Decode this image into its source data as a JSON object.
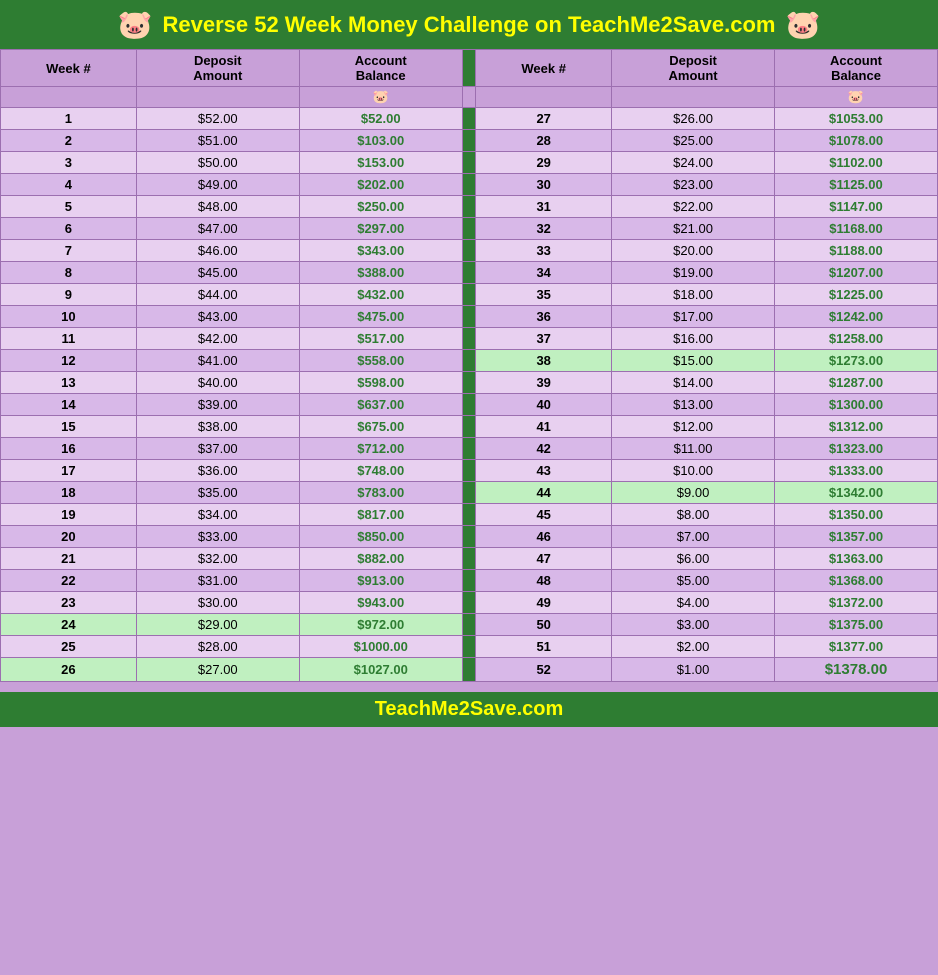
{
  "header": {
    "title": "Reverse 52 Week Money Challenge on TeachMe2Save.com",
    "pig_left": "🐷",
    "pig_right": "🐷"
  },
  "columns": {
    "week": "Week #",
    "deposit": "Deposit Amount",
    "balance": "Account Balance"
  },
  "footer": {
    "text": "TeachMe2Save.com"
  },
  "left_rows": [
    {
      "week": "1",
      "deposit": "$52.00",
      "balance": "$52.00",
      "highlight": false
    },
    {
      "week": "2",
      "deposit": "$51.00",
      "balance": "$103.00",
      "highlight": false
    },
    {
      "week": "3",
      "deposit": "$50.00",
      "balance": "$153.00",
      "highlight": false
    },
    {
      "week": "4",
      "deposit": "$49.00",
      "balance": "$202.00",
      "highlight": false
    },
    {
      "week": "5",
      "deposit": "$48.00",
      "balance": "$250.00",
      "highlight": false
    },
    {
      "week": "6",
      "deposit": "$47.00",
      "balance": "$297.00",
      "highlight": false
    },
    {
      "week": "7",
      "deposit": "$46.00",
      "balance": "$343.00",
      "highlight": false
    },
    {
      "week": "8",
      "deposit": "$45.00",
      "balance": "$388.00",
      "highlight": false
    },
    {
      "week": "9",
      "deposit": "$44.00",
      "balance": "$432.00",
      "highlight": false
    },
    {
      "week": "10",
      "deposit": "$43.00",
      "balance": "$475.00",
      "highlight": false
    },
    {
      "week": "11",
      "deposit": "$42.00",
      "balance": "$517.00",
      "highlight": false
    },
    {
      "week": "12",
      "deposit": "$41.00",
      "balance": "$558.00",
      "highlight": false
    },
    {
      "week": "13",
      "deposit": "$40.00",
      "balance": "$598.00",
      "highlight": false
    },
    {
      "week": "14",
      "deposit": "$39.00",
      "balance": "$637.00",
      "highlight": false
    },
    {
      "week": "15",
      "deposit": "$38.00",
      "balance": "$675.00",
      "highlight": false
    },
    {
      "week": "16",
      "deposit": "$37.00",
      "balance": "$712.00",
      "highlight": false
    },
    {
      "week": "17",
      "deposit": "$36.00",
      "balance": "$748.00",
      "highlight": false
    },
    {
      "week": "18",
      "deposit": "$35.00",
      "balance": "$783.00",
      "highlight": false
    },
    {
      "week": "19",
      "deposit": "$34.00",
      "balance": "$817.00",
      "highlight": false
    },
    {
      "week": "20",
      "deposit": "$33.00",
      "balance": "$850.00",
      "highlight": false
    },
    {
      "week": "21",
      "deposit": "$32.00",
      "balance": "$882.00",
      "highlight": false
    },
    {
      "week": "22",
      "deposit": "$31.00",
      "balance": "$913.00",
      "highlight": false
    },
    {
      "week": "23",
      "deposit": "$30.00",
      "balance": "$943.00",
      "highlight": false
    },
    {
      "week": "24",
      "deposit": "$29.00",
      "balance": "$972.00",
      "highlight": true
    },
    {
      "week": "25",
      "deposit": "$28.00",
      "balance": "$1000.00",
      "highlight": false
    },
    {
      "week": "26",
      "deposit": "$27.00",
      "balance": "$1027.00",
      "highlight": true
    }
  ],
  "right_rows": [
    {
      "week": "27",
      "deposit": "$26.00",
      "balance": "$1053.00",
      "highlight": false
    },
    {
      "week": "28",
      "deposit": "$25.00",
      "balance": "$1078.00",
      "highlight": false
    },
    {
      "week": "29",
      "deposit": "$24.00",
      "balance": "$1102.00",
      "highlight": false
    },
    {
      "week": "30",
      "deposit": "$23.00",
      "balance": "$1125.00",
      "highlight": false
    },
    {
      "week": "31",
      "deposit": "$22.00",
      "balance": "$1147.00",
      "highlight": false
    },
    {
      "week": "32",
      "deposit": "$21.00",
      "balance": "$1168.00",
      "highlight": false
    },
    {
      "week": "33",
      "deposit": "$20.00",
      "balance": "$1188.00",
      "highlight": false
    },
    {
      "week": "34",
      "deposit": "$19.00",
      "balance": "$1207.00",
      "highlight": false
    },
    {
      "week": "35",
      "deposit": "$18.00",
      "balance": "$1225.00",
      "highlight": false
    },
    {
      "week": "36",
      "deposit": "$17.00",
      "balance": "$1242.00",
      "highlight": false
    },
    {
      "week": "37",
      "deposit": "$16.00",
      "balance": "$1258.00",
      "highlight": false
    },
    {
      "week": "38",
      "deposit": "$15.00",
      "balance": "$1273.00",
      "highlight": true
    },
    {
      "week": "39",
      "deposit": "$14.00",
      "balance": "$1287.00",
      "highlight": false
    },
    {
      "week": "40",
      "deposit": "$13.00",
      "balance": "$1300.00",
      "highlight": false
    },
    {
      "week": "41",
      "deposit": "$12.00",
      "balance": "$1312.00",
      "highlight": false
    },
    {
      "week": "42",
      "deposit": "$11.00",
      "balance": "$1323.00",
      "highlight": false
    },
    {
      "week": "43",
      "deposit": "$10.00",
      "balance": "$1333.00",
      "highlight": false
    },
    {
      "week": "44",
      "deposit": "$9.00",
      "balance": "$1342.00",
      "highlight": true
    },
    {
      "week": "45",
      "deposit": "$8.00",
      "balance": "$1350.00",
      "highlight": false
    },
    {
      "week": "46",
      "deposit": "$7.00",
      "balance": "$1357.00",
      "highlight": false
    },
    {
      "week": "47",
      "deposit": "$6.00",
      "balance": "$1363.00",
      "highlight": false
    },
    {
      "week": "48",
      "deposit": "$5.00",
      "balance": "$1368.00",
      "highlight": false
    },
    {
      "week": "49",
      "deposit": "$4.00",
      "balance": "$1372.00",
      "highlight": false
    },
    {
      "week": "50",
      "deposit": "$3.00",
      "balance": "$1375.00",
      "highlight": false
    },
    {
      "week": "51",
      "deposit": "$2.00",
      "balance": "$1377.00",
      "highlight": false
    },
    {
      "week": "52",
      "deposit": "$1.00",
      "balance": "$1378.00",
      "highlight": false,
      "last": true
    }
  ]
}
